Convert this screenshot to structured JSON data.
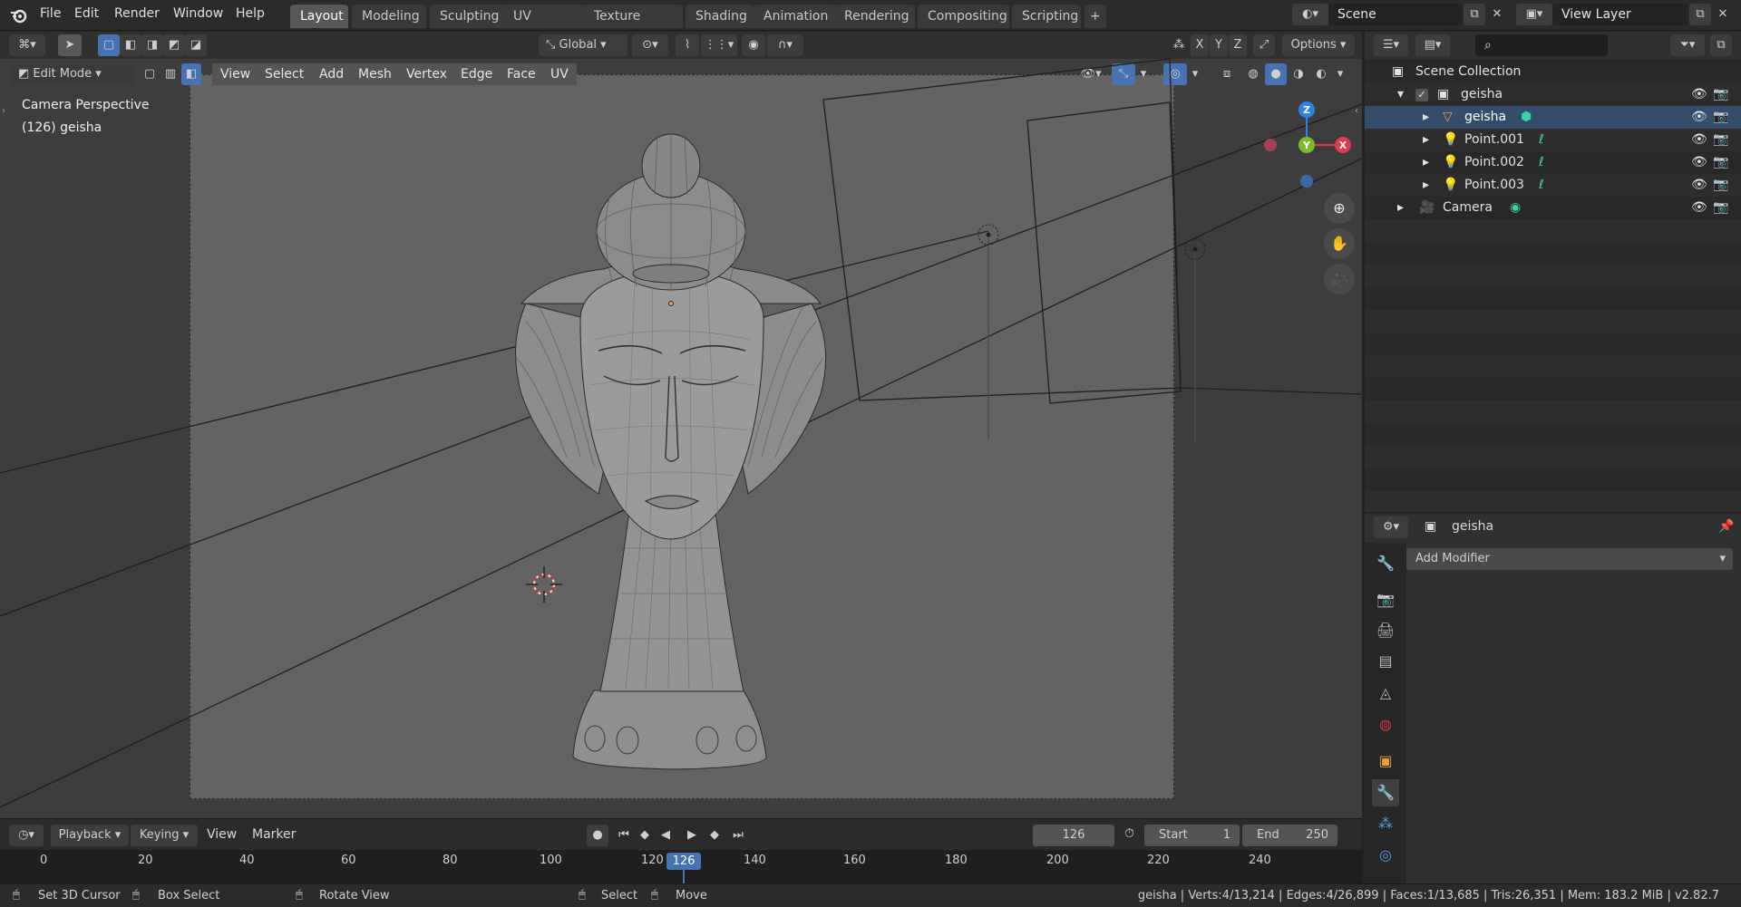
{
  "topbar": {
    "menus": [
      "File",
      "Edit",
      "Render",
      "Window",
      "Help"
    ],
    "workspaces": [
      "Layout",
      "Modeling",
      "Sculpting",
      "UV Editing",
      "Texture Paint",
      "Shading",
      "Animation",
      "Rendering",
      "Compositing",
      "Scripting"
    ],
    "active_workspace": "Layout",
    "add_tab": "+",
    "scene_label": "Scene",
    "view_layer_label": "View Layer"
  },
  "viewport_header": {
    "transform_orientation": "Global",
    "axis_x": "X",
    "axis_y": "Y",
    "axis_z": "Z",
    "options": "Options",
    "mode": "Edit Mode",
    "menus": [
      "View",
      "Select",
      "Add",
      "Mesh",
      "Vertex",
      "Edge",
      "Face",
      "UV"
    ]
  },
  "viewport": {
    "overlay_title": "Camera Perspective",
    "overlay_object": "(126) geisha",
    "gizmo": {
      "x": "X",
      "y": "Y",
      "z": "Z"
    }
  },
  "outliner": {
    "root": "Scene Collection",
    "items": [
      {
        "label": "geisha",
        "type": "collection",
        "depth": 1
      },
      {
        "label": "geisha",
        "type": "mesh",
        "depth": 2,
        "selected": true
      },
      {
        "label": "Point.001",
        "type": "light",
        "depth": 2
      },
      {
        "label": "Point.002",
        "type": "light",
        "depth": 2
      },
      {
        "label": "Point.003",
        "type": "light",
        "depth": 2
      },
      {
        "label": "Camera",
        "type": "camera",
        "depth": 1
      }
    ]
  },
  "properties": {
    "object_name": "geisha",
    "add_modifier": "Add Modifier"
  },
  "timeline": {
    "playback": "Playback",
    "keying": "Keying",
    "view": "View",
    "marker": "Marker",
    "current_frame": "126",
    "start_label": "Start",
    "start_value": "1",
    "end_label": "End",
    "end_value": "250",
    "ticks": [
      "0",
      "20",
      "40",
      "60",
      "80",
      "100",
      "120",
      "140",
      "160",
      "180",
      "200",
      "220",
      "240"
    ],
    "playhead": "126"
  },
  "statusbar": {
    "hint1": "Set 3D Cursor",
    "hint2": "Box Select",
    "hint3": "Rotate View",
    "hint4": "Select",
    "hint5": "Move",
    "stats": "geisha | Verts:4/13,214 | Edges:4/26,899 | Faces:1/13,685 | Tris:26,351 | Mem: 183.2 MiB | v2.82.7"
  },
  "colors": {
    "accent": "#4772b3",
    "selected_row": "#334d6b",
    "axis_x": "#e0394f",
    "axis_y": "#7cbb2a",
    "axis_z": "#2d82e6"
  }
}
